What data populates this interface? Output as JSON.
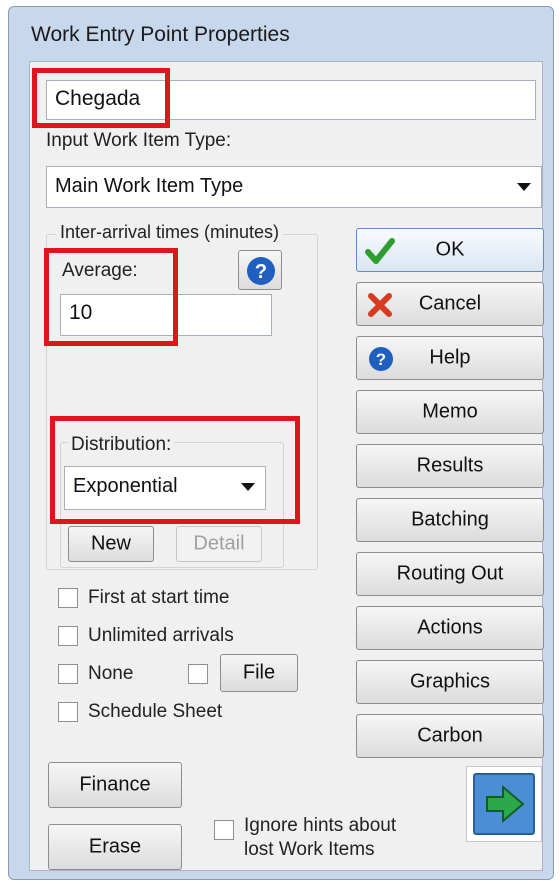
{
  "window": {
    "title": "Work Entry Point Properties"
  },
  "name_field": {
    "value": "Chegada"
  },
  "input_type": {
    "label": "Input Work Item Type:",
    "selected": "Main Work Item Type"
  },
  "inter_arrival": {
    "group_label": "Inter-arrival times (minutes)",
    "average_label": "Average:",
    "average_value": "10",
    "distribution_label": "Distribution:",
    "distribution_selected": "Exponential",
    "new_label": "New",
    "detail_label": "Detail"
  },
  "options": {
    "first_at_start": "First at start time",
    "unlimited_arrivals": "Unlimited arrivals",
    "none": "None",
    "file": "File",
    "schedule_sheet": "Schedule Sheet"
  },
  "side_buttons": {
    "ok": "OK",
    "cancel": "Cancel",
    "help": "Help",
    "memo": "Memo",
    "results": "Results",
    "batching": "Batching",
    "routing_out": "Routing Out",
    "actions": "Actions",
    "graphics": "Graphics",
    "carbon": "Carbon"
  },
  "bottom": {
    "finance": "Finance",
    "erase": "Erase",
    "ignore_hints": "Ignore hints about lost Work Items"
  },
  "colors": {
    "highlight_red": "#e0141b",
    "ok_check": "#2e9e2e",
    "cancel_x": "#d63b1f",
    "help_blue": "#1f5fbf",
    "arrow_green": "#2aa84a"
  }
}
